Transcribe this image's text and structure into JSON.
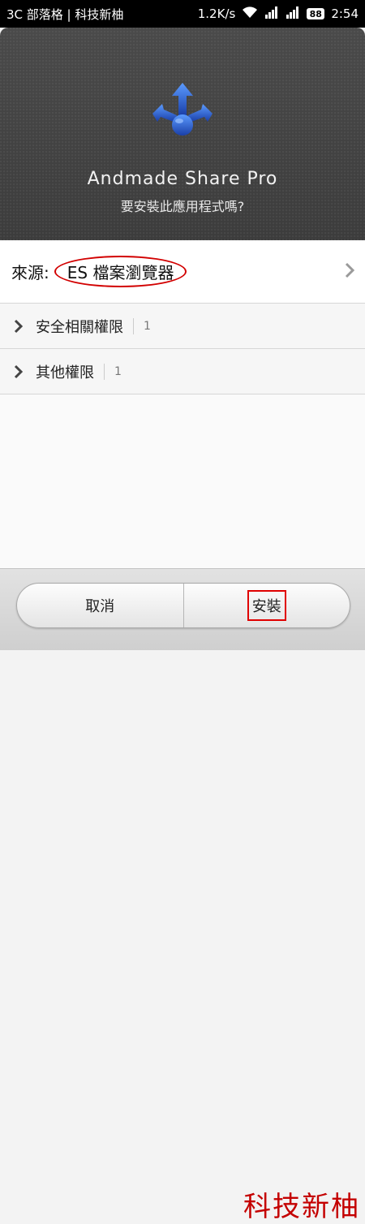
{
  "status_bar": {
    "carrier_text": "3C 部落格 | 科技新柚",
    "network_speed": "1.2K/s",
    "battery_level": "88",
    "time": "2:54"
  },
  "header": {
    "app_name": "Andmade Share Pro",
    "question": "要安裝此應用程式嗎?",
    "icon": "share-arrows-icon"
  },
  "source": {
    "label": "來源:",
    "value": "ES 檔案瀏覽器"
  },
  "permissions": [
    {
      "label": "安全相關權限",
      "count": "1"
    },
    {
      "label": "其他權限",
      "count": "1"
    }
  ],
  "buttons": {
    "cancel": "取消",
    "install": "安裝"
  },
  "watermark": "科技新柚",
  "colors": {
    "highlight": "#d20000",
    "icon_blue": "#1f5fd1"
  }
}
